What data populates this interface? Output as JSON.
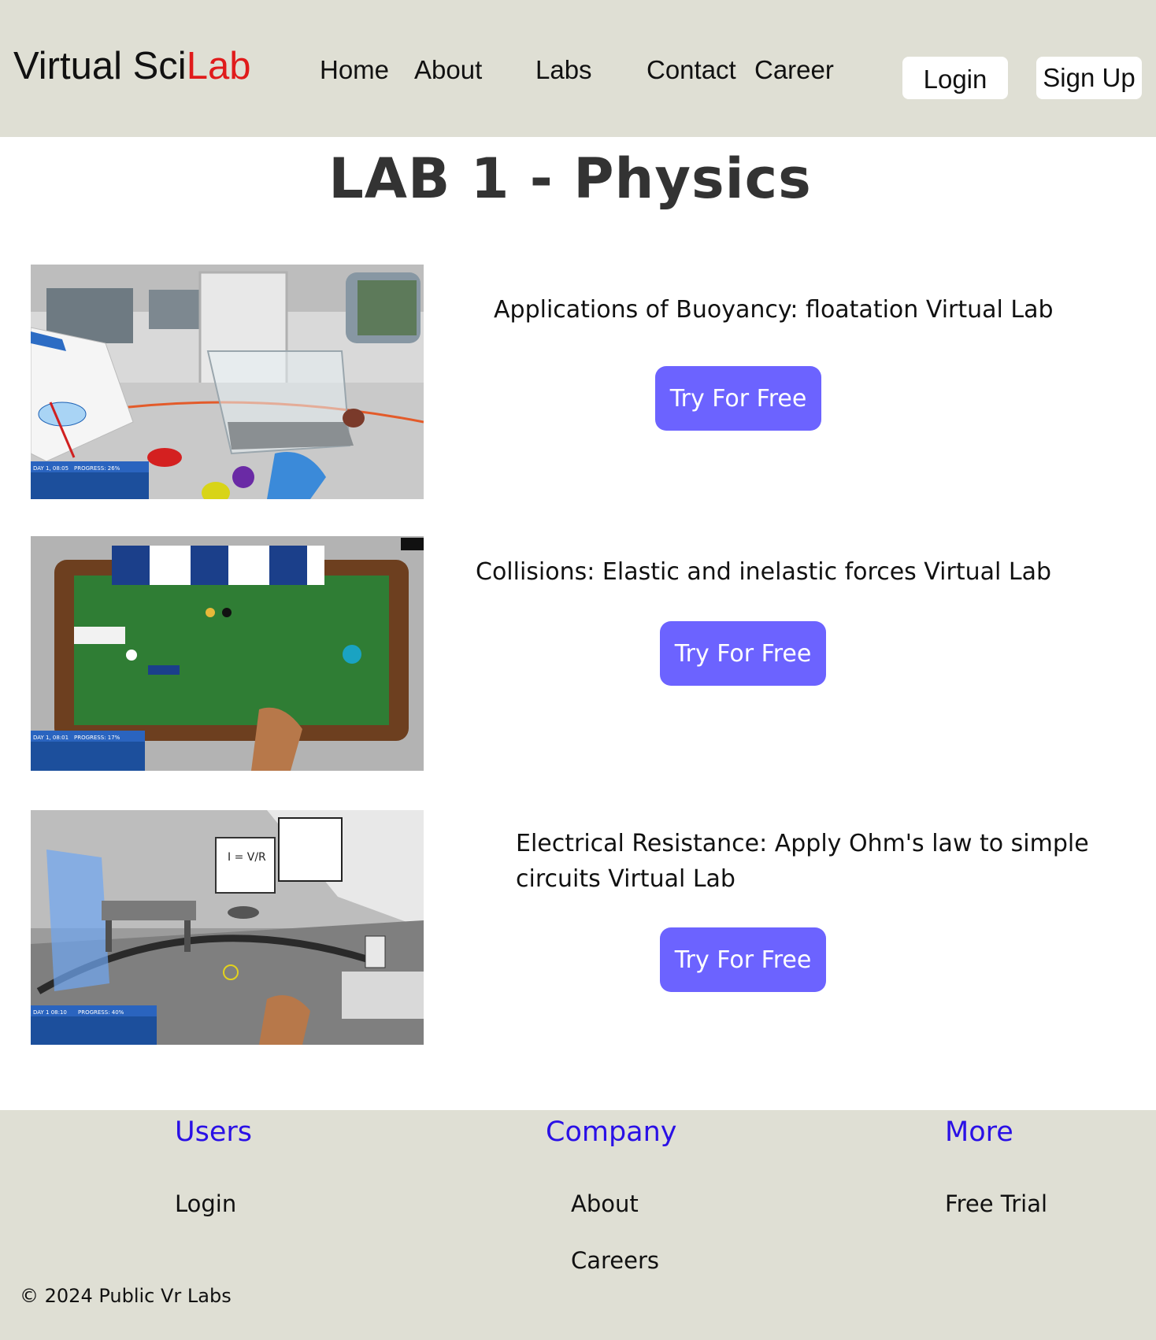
{
  "header": {
    "logo_part1": "Virtual Sci",
    "logo_part2": "Lab",
    "nav": [
      "Home",
      "About",
      "Labs",
      "Contact",
      "Career"
    ],
    "login_label": "Login",
    "signup_label": "Sign Up"
  },
  "page": {
    "title": "LAB 1 - Physics"
  },
  "labs": [
    {
      "name": "Applications of Buoyancy: floatation Virtual Lab",
      "button": "Try For Free",
      "hud": {
        "day": "DAY 1, 08:05",
        "progress": "PROGRESS: 26%"
      }
    },
    {
      "name": "Collisions: Elastic and inelastic forces Virtual Lab",
      "button": "Try For Free",
      "hud": {
        "day": "DAY 1, 08:01",
        "progress": "PROGRESS: 17%"
      }
    },
    {
      "name_line1": "Electrical Resistance: Apply Ohm's law to simple",
      "name_line2": "circuits Virtual Lab",
      "button": "Try For Free",
      "hud": {
        "day": "DAY 1   08:10",
        "progress": "PROGRESS: 40%"
      }
    }
  ],
  "footer": {
    "columns": [
      {
        "heading": "Users",
        "links": [
          "Login"
        ]
      },
      {
        "heading": "Company",
        "links": [
          "About",
          "Careers"
        ]
      },
      {
        "heading": "More",
        "links": [
          "Free Trial"
        ]
      }
    ],
    "copyright": "© 2024 Public Vr Labs"
  },
  "colors": {
    "header_bg": "#dfdfd4",
    "accent_red": "#e01b1b",
    "button_purple": "#6c63ff",
    "footer_heading_blue": "#2a10e6"
  }
}
